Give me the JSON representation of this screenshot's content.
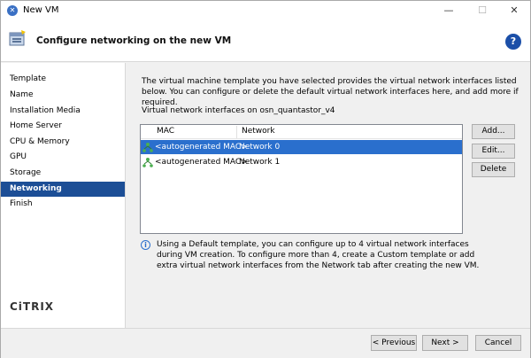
{
  "window": {
    "title": "New VM"
  },
  "header": {
    "title": "Configure networking on the new VM",
    "help": "?"
  },
  "sidebar": {
    "items": [
      {
        "label": "Template"
      },
      {
        "label": "Name"
      },
      {
        "label": "Installation Media"
      },
      {
        "label": "Home Server"
      },
      {
        "label": "CPU & Memory"
      },
      {
        "label": "GPU"
      },
      {
        "label": "Storage"
      },
      {
        "label": "Networking",
        "active": true
      },
      {
        "label": "Finish"
      }
    ],
    "logo": "CiTRIX"
  },
  "main": {
    "intro": "The virtual machine template you have selected provides the virtual network interfaces listed below. You can configure or delete the default virtual network interfaces here, and add more if required.",
    "list_caption": "Virtual network interfaces on osn_quantastor_v4",
    "columns": {
      "mac": "MAC",
      "network": "Network"
    },
    "rows": [
      {
        "mac": "<autogenerated MAC>",
        "network": "Network 0",
        "selected": true
      },
      {
        "mac": "<autogenerated MAC>",
        "network": "Network 1",
        "selected": false
      }
    ],
    "buttons": {
      "add": "Add...",
      "edit": "Edit...",
      "delete": "Delete"
    },
    "info": "Using a Default template, you can configure up to 4 virtual network interfaces during VM creation. To configure more than 4, create a Custom template or add extra virtual network interfaces from the Network tab after creating the new VM."
  },
  "footer": {
    "previous": "< Previous",
    "next": "Next >",
    "cancel": "Cancel"
  },
  "colors": {
    "accent": "#1c4e96",
    "selection": "#2a6fcd"
  }
}
